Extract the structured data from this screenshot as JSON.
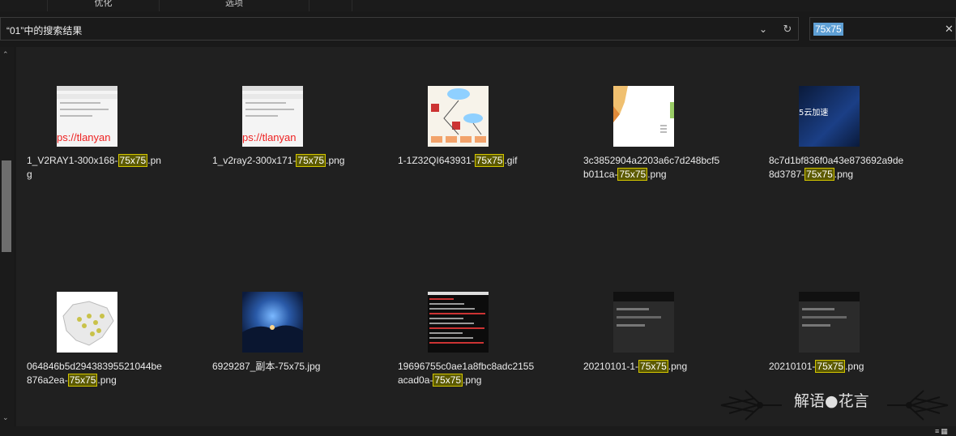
{
  "ribbon": {
    "tabs": [
      "优化",
      "选项"
    ]
  },
  "address": {
    "path": "“01”中的搜索结果"
  },
  "search": {
    "query": "75x75"
  },
  "watermark": {
    "text": "解语●花言"
  },
  "items": [
    {
      "pre": "1_V2RAY1-300x168-",
      "hl": "75x75",
      "post": ".png",
      "kind": "web",
      "thumb_text": "ps://tlanyan"
    },
    {
      "pre": "1_v2ray2-300x171-",
      "hl": "75x75",
      "post": ".png",
      "kind": "web",
      "thumb_text": "ps://tlanyan"
    },
    {
      "pre": "1-1Z32QI643931-",
      "hl": "75x75",
      "post": ".gif",
      "kind": "diag",
      "thumb_text": ""
    },
    {
      "pre": "3c3852904a2203a6c7d248bcf5b011ca-",
      "hl": "75x75",
      "post": ".png",
      "kind": "chart",
      "thumb_text": ""
    },
    {
      "pre": "8c7d1bf836f0a43e873692a9de8d3787-",
      "hl": "75x75",
      "post": ".png",
      "kind": "blue",
      "thumb_text": "5云加速"
    },
    {
      "pre": "064846b5d29438395521044be876a2ea-",
      "hl": "75x75",
      "post": ".png",
      "kind": "map",
      "thumb_text": ""
    },
    {
      "pre": "6929287_副本-75x75.jpg",
      "hl": "",
      "post": "",
      "kind": "night",
      "thumb_text": ""
    },
    {
      "pre": "19696755c0ae1a8fbc8adc2155acad0a-",
      "hl": "75x75",
      "post": ".png",
      "kind": "term",
      "thumb_text": ""
    },
    {
      "pre": "20210101-1-",
      "hl": "75x75",
      "post": ".png",
      "kind": "dark",
      "thumb_text": ""
    },
    {
      "pre": "20210101-",
      "hl": "75x75",
      "post": ".png",
      "kind": "dark",
      "thumb_text": ""
    }
  ]
}
